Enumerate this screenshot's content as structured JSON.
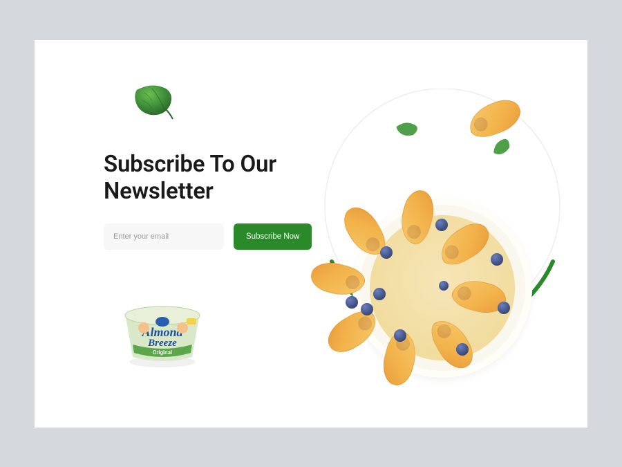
{
  "newsletter": {
    "heading": "Subscribe To Our Newsletter",
    "email_placeholder": "Enter your email",
    "email_value": "",
    "button_label": "Subscribe Now"
  },
  "icons": {
    "leaf": "leaf-icon",
    "product": "yogurt-cup-icon",
    "hero": "fruit-bowl-image"
  },
  "colors": {
    "accent": "#2a8a2a",
    "page_bg": "#d5d8dc",
    "card_bg": "#ffffff",
    "input_bg": "#f7f7f7"
  }
}
